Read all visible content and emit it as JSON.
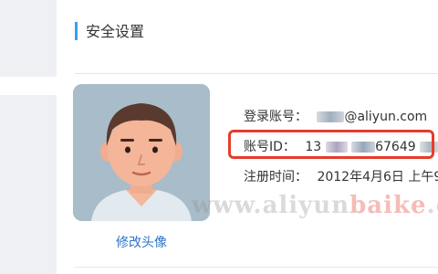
{
  "section": {
    "title": "安全设置"
  },
  "avatar": {
    "change_link": "修改头像"
  },
  "info": {
    "login_account": {
      "label": "登录账号：",
      "suffix": "@aliyun.com"
    },
    "account_id": {
      "label": "账号ID：",
      "prefix": "13",
      "middle": "67649"
    },
    "register_time": {
      "label": "注册时间：",
      "value": "2012年4月6日 上午9"
    }
  },
  "watermark": {
    "part1": "www.aliyun",
    "part2": "baike",
    "part3": ".c"
  },
  "colors": {
    "accent_bar": "#3f9ee6",
    "link": "#2b74c8",
    "highlight_border": "#e53d2c",
    "left_panel": "#eef0f3"
  }
}
